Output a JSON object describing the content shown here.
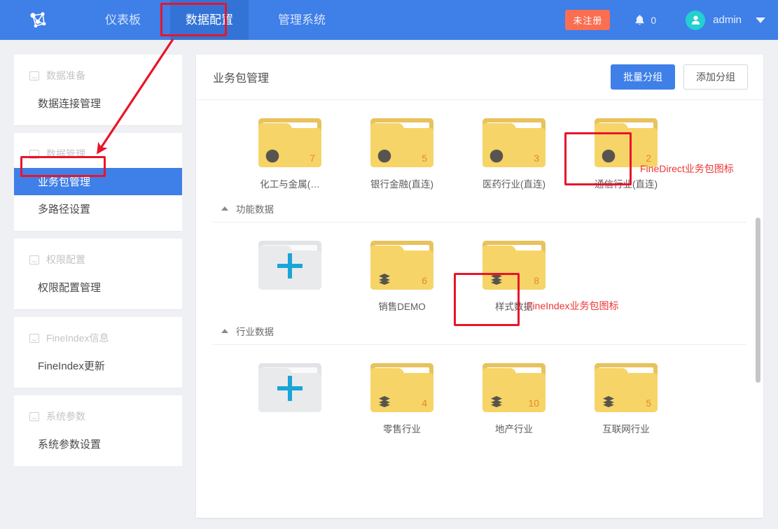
{
  "header": {
    "logo_icon": "network-graph-logo",
    "nav": [
      {
        "label": "仪表板",
        "active": false
      },
      {
        "label": "数据配置",
        "active": true
      },
      {
        "label": "管理系统",
        "active": false
      }
    ],
    "unregistered_badge": "未注册",
    "notification_icon": "bell-icon",
    "notification_count": "0",
    "avatar_icon": "user-avatar-icon",
    "username": "admin",
    "caret_icon": "chevron-down-icon",
    "brand_color": "#3e7fe8",
    "badge_color": "#fb6e52"
  },
  "sidebar": {
    "groups": [
      {
        "title": "数据准备",
        "icon": "inbox-icon",
        "items": [
          {
            "label": "数据连接管理",
            "active": false
          }
        ]
      },
      {
        "title": "数据管理",
        "icon": "inbox-icon",
        "items": [
          {
            "label": "业务包管理",
            "active": true
          },
          {
            "label": "多路径设置",
            "active": false
          }
        ]
      },
      {
        "title": "权限配置",
        "icon": "inbox-icon",
        "items": [
          {
            "label": "权限配置管理",
            "active": false
          }
        ]
      },
      {
        "title": "FineIndex信息",
        "icon": "inbox-icon",
        "items": [
          {
            "label": "FineIndex更新",
            "active": false
          }
        ]
      },
      {
        "title": "系统参数",
        "icon": "inbox-icon",
        "items": [
          {
            "label": "系统参数设置",
            "active": false
          }
        ]
      }
    ]
  },
  "main": {
    "title": "业务包管理",
    "batch_group_button": "批量分组",
    "add_group_button": "添加分组",
    "sections": [
      {
        "id": "ungrouped",
        "header": null,
        "tiles": [
          {
            "type": "folder",
            "icon": "pie-clock-badge-icon",
            "count": "7",
            "label": "化工与金属(…"
          },
          {
            "type": "folder",
            "icon": "pie-clock-badge-icon",
            "count": "5",
            "label": "银行金融(直连)"
          },
          {
            "type": "folder",
            "icon": "pie-clock-badge-icon",
            "count": "3",
            "label": "医药行业(直连)"
          },
          {
            "type": "folder",
            "icon": "pie-clock-badge-icon",
            "count": "2",
            "label": "通信行业(直连)"
          }
        ]
      },
      {
        "id": "function-data",
        "header": {
          "label": "功能数据",
          "toggle_icon": "triangle-up-icon"
        },
        "tiles": [
          {
            "type": "add",
            "icon": "plus-icon",
            "count": "",
            "label": ""
          },
          {
            "type": "folder",
            "icon": "layers-badge-icon",
            "count": "6",
            "label": "销售DEMO"
          },
          {
            "type": "folder",
            "icon": "layers-badge-icon",
            "count": "8",
            "label": "样式数据"
          }
        ]
      },
      {
        "id": "industry-data",
        "header": {
          "label": "行业数据",
          "toggle_icon": "triangle-up-icon"
        },
        "tiles": [
          {
            "type": "add",
            "icon": "plus-icon",
            "count": "",
            "label": ""
          },
          {
            "type": "folder",
            "icon": "layers-badge-icon",
            "count": "4",
            "label": "零售行业"
          },
          {
            "type": "folder",
            "icon": "layers-badge-icon",
            "count": "10",
            "label": "地产行业"
          },
          {
            "type": "folder",
            "icon": "layers-badge-icon",
            "count": "5",
            "label": "互联网行业"
          }
        ]
      }
    ]
  },
  "annotations": {
    "color": "#ef3434",
    "box_color": "#e8152a",
    "labels": [
      {
        "id": "finedirect",
        "text": "FineDirect业务包图标"
      },
      {
        "id": "fineindex",
        "text": "FineIndex业务包图标"
      }
    ]
  }
}
